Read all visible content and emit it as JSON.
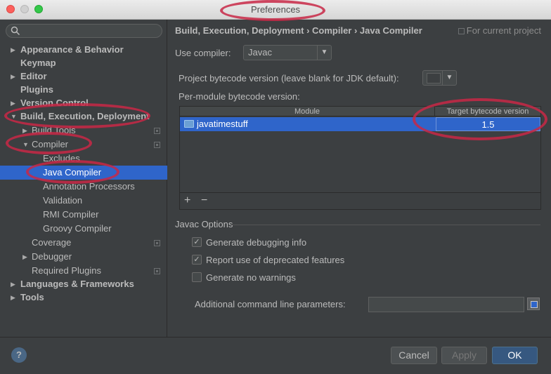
{
  "window": {
    "title": "Preferences"
  },
  "sidebar": {
    "search_placeholder": "",
    "items": [
      {
        "label": "Appearance & Behavior",
        "bold": true
      },
      {
        "label": "Keymap",
        "bold": true
      },
      {
        "label": "Editor",
        "bold": true
      },
      {
        "label": "Plugins",
        "bold": true
      },
      {
        "label": "Version Control",
        "bold": true
      },
      {
        "label": "Build, Execution, Deployment",
        "bold": true
      },
      {
        "label": "Build Tools"
      },
      {
        "label": "Compiler"
      },
      {
        "label": "Excludes"
      },
      {
        "label": "Java Compiler",
        "selected": true
      },
      {
        "label": "Annotation Processors"
      },
      {
        "label": "Validation"
      },
      {
        "label": "RMI Compiler"
      },
      {
        "label": "Groovy Compiler"
      },
      {
        "label": "Coverage"
      },
      {
        "label": "Debugger"
      },
      {
        "label": "Required Plugins"
      },
      {
        "label": "Languages & Frameworks",
        "bold": true
      },
      {
        "label": "Tools",
        "bold": true
      }
    ]
  },
  "header": {
    "breadcrumb": "Build, Execution, Deployment › Compiler › Java Compiler",
    "scope": "For current project"
  },
  "compiler": {
    "use_compiler_label": "Use compiler:",
    "use_compiler_value": "Javac",
    "bytecode_label": "Project bytecode version (leave blank for JDK default):",
    "per_module_label": "Per-module bytecode version:"
  },
  "table": {
    "headers": [
      "Module",
      "Target bytecode version"
    ],
    "rows": [
      {
        "module": "javatimestuff",
        "version": "1.5"
      }
    ],
    "add_label": "+",
    "remove_label": "−"
  },
  "javac_options": {
    "title": "Javac Options",
    "debug_info": {
      "label": "Generate debugging info",
      "checked": true
    },
    "deprecated": {
      "label": "Report use of deprecated features",
      "checked": true
    },
    "no_warnings": {
      "label": "Generate no warnings",
      "checked": false
    },
    "additional_label": "Additional command line parameters:",
    "additional_value": ""
  },
  "buttons": {
    "help": "?",
    "cancel": "Cancel",
    "apply": "Apply",
    "ok": "OK"
  },
  "colors": {
    "accent": "#2f65ca",
    "background": "#3c3f41",
    "highlight": "#c82846"
  }
}
